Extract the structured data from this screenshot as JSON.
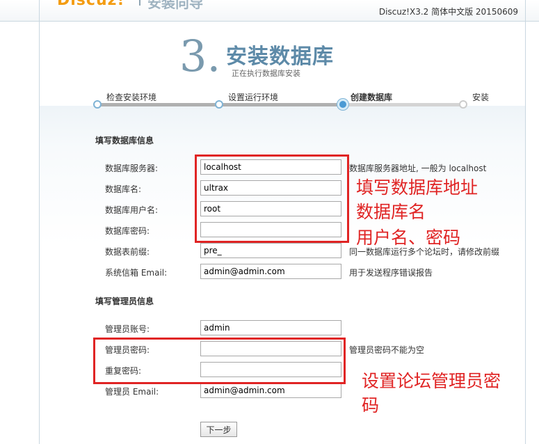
{
  "header": {
    "logo_text": "Discuz!",
    "logo_tail": "安装向导",
    "version": "Discuz!X3.2 简体中文版 20150609"
  },
  "step": {
    "number": "3.",
    "title": "安装数据库",
    "subtitle": "正在执行数据库安装"
  },
  "progress": {
    "steps": [
      {
        "label": "检查安装环境",
        "state": "done"
      },
      {
        "label": "设置运行环境",
        "state": "done"
      },
      {
        "label": "创建数据库",
        "state": "current"
      },
      {
        "label": "安装",
        "state": "pending"
      }
    ]
  },
  "db_section": {
    "title": "填写数据库信息",
    "fields": [
      {
        "label": "数据库服务器:",
        "value": "localhost",
        "hint": "数据库服务器地址, 一般为 localhost"
      },
      {
        "label": "数据库名:",
        "value": "ultrax",
        "hint": ""
      },
      {
        "label": "数据库用户名:",
        "value": "root",
        "hint": ""
      },
      {
        "label": "数据库密码:",
        "value": "",
        "hint": ""
      },
      {
        "label": "数据表前缀:",
        "value": "pre_",
        "hint": "同一数据库运行多个论坛时，请修改前缀"
      },
      {
        "label": "系统信箱 Email:",
        "value": "admin@admin.com",
        "hint": "用于发送程序错误报告"
      }
    ]
  },
  "admin_section": {
    "title": "填写管理员信息",
    "fields": [
      {
        "label": "管理员账号:",
        "value": "admin",
        "hint": ""
      },
      {
        "label": "管理员密码:",
        "value": "",
        "hint": "管理员密码不能为空"
      },
      {
        "label": "重复密码:",
        "value": "",
        "hint": ""
      },
      {
        "label": "管理员 Email:",
        "value": "admin@admin.com",
        "hint": ""
      }
    ]
  },
  "annotations": {
    "db_line1": "填写数据库地址",
    "db_line2": "数据库名",
    "db_line3": "用户名、密码",
    "admin_line1": "设置论坛管理员密",
    "admin_line2": "码"
  },
  "actions": {
    "next_label": "下一步"
  },
  "colors": {
    "annotation_red": "#e02424",
    "title_blue": "#5d8aa8",
    "step_current": "#4a9ad4"
  }
}
